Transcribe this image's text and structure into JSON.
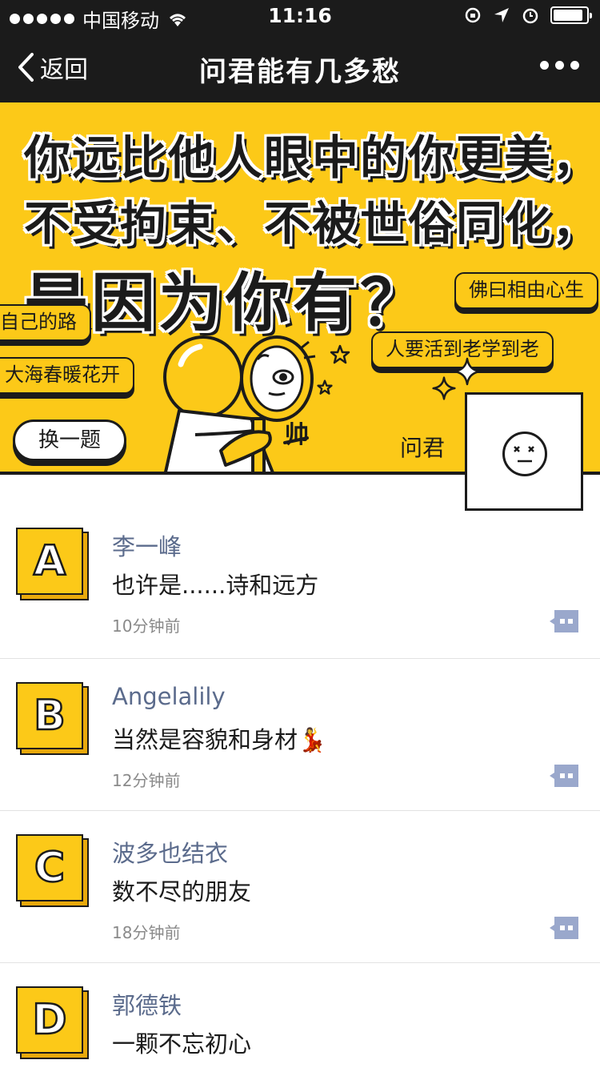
{
  "status_bar": {
    "carrier": "中国移动",
    "time": "11:16",
    "battery_level": 0.9
  },
  "navbar": {
    "back_label": "返回",
    "title": "问君能有几多愁"
  },
  "banner": {
    "headline_lines": [
      "你远比他人眼中的你更美，",
      "不受拘束、不被世俗同化，",
      "是因为你有？"
    ],
    "chips": {
      "fo": "佛曰相由心生",
      "zi": "自己的路",
      "ren": "人要活到老学到老",
      "da": "大海春暖花开"
    },
    "swap_button": "换一题",
    "character_caption": "帅",
    "author_label": "问君"
  },
  "answers": [
    {
      "letter": "A",
      "name": "李一峰",
      "text": "也许是......诗和远方",
      "time": "10分钟前"
    },
    {
      "letter": "B",
      "name": "Angelalily",
      "text": "当然是容貌和身材💃",
      "time": "12分钟前"
    },
    {
      "letter": "C",
      "name": "波多也结衣",
      "text": "数不尽的朋友",
      "time": "18分钟前"
    },
    {
      "letter": "D",
      "name": "郭德铁",
      "text": "一颗不忘初心",
      "time": ""
    }
  ],
  "colors": {
    "accent_yellow": "#fcc918",
    "dark": "#1b1b1b",
    "name_blue": "#5b6b8c",
    "comment_icon": "#9aa8cc"
  }
}
